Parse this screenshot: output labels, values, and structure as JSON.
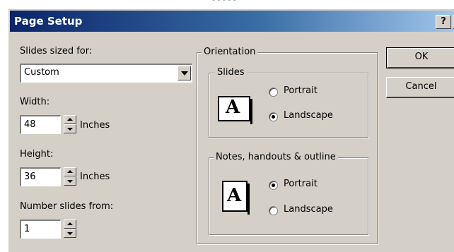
{
  "window": {
    "title": "Page Setup",
    "help_glyph": "?",
    "close_glyph": "×",
    "partial_text_above": "- - - - -"
  },
  "slides_sized_for": {
    "label": "Slides sized for:",
    "value": "Custom"
  },
  "width": {
    "label": "Width:",
    "value": "48",
    "unit": "Inches"
  },
  "height": {
    "label": "Height:",
    "value": "36",
    "unit": "Inches"
  },
  "number_slides_from": {
    "label": "Number slides from:",
    "value": "1"
  },
  "orientation": {
    "label": "Orientation",
    "slides": {
      "label": "Slides",
      "icon_letter": "A",
      "options": [
        {
          "label": "Portrait",
          "selected": false
        },
        {
          "label": "Landscape",
          "selected": true
        }
      ]
    },
    "notes": {
      "label": "Notes, handouts & outline",
      "icon_letter": "A",
      "options": [
        {
          "label": "Portrait",
          "selected": true
        },
        {
          "label": "Landscape",
          "selected": false
        }
      ]
    }
  },
  "buttons": {
    "ok": "OK",
    "cancel": "Cancel"
  },
  "colors": {
    "dialog_face": "#d4d0c8",
    "titlebar_start": "#0a246a",
    "titlebar_end": "#a6caf0"
  }
}
